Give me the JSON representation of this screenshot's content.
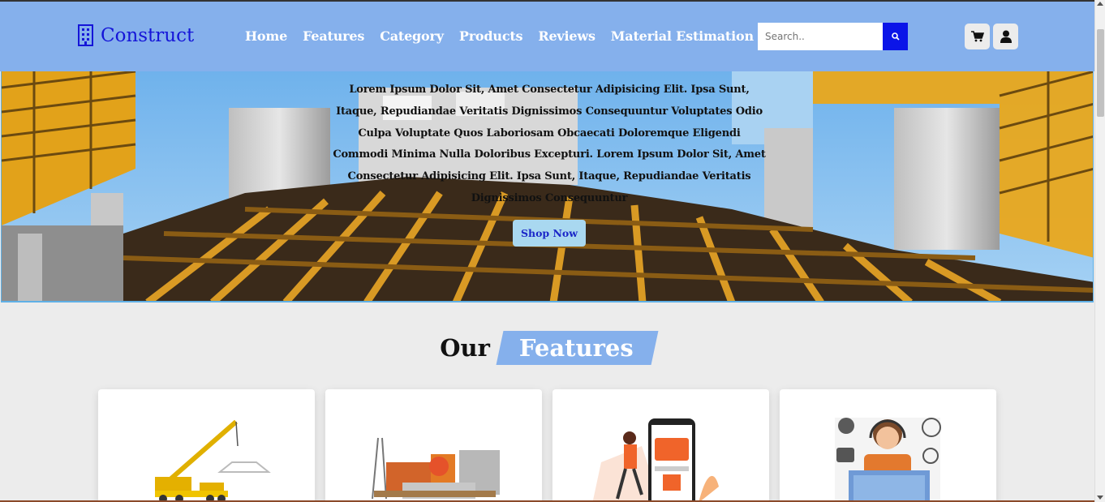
{
  "header": {
    "logo_text": "Construct",
    "nav": [
      "Home",
      "Features",
      "Category",
      "Products",
      "Reviews",
      "Material Estimation"
    ],
    "search_placeholder": "Search.."
  },
  "hero": {
    "text": "Lorem Ipsum Dolor Sit, Amet Consectetur Adipisicing Elit. Ipsa Sunt, Itaque, Repudiandae Veritatis Dignissimos Consequuntur Voluptates Odio Culpa Voluptate Quos Laboriosam Obcaecati Doloremque Eligendi Commodi Minima Nulla Doloribus Excepturi. Lorem Ipsum Dolor Sit, Amet Consectetur Adipisicing Elit. Ipsa Sunt, Itaque, Repudiandae Veritatis Dignissimos Consequuntur",
    "button_label": "Shop Now"
  },
  "features": {
    "heading_our": "Our",
    "heading_features": "Features",
    "cards": [
      {
        "icon": "crane-icon"
      },
      {
        "icon": "building-materials-icon"
      },
      {
        "icon": "mobile-app-icon"
      },
      {
        "icon": "customer-support-icon"
      }
    ]
  },
  "colors": {
    "header_bg": "#85b0ec",
    "logo": "#1515d8",
    "search_button": "#0b15e8",
    "page_bg": "#ececec"
  }
}
